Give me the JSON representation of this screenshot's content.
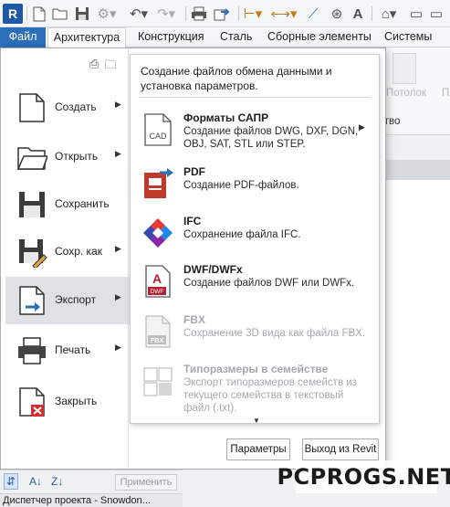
{
  "app": {
    "logo_letter": "R"
  },
  "quick_access": {
    "icons": [
      "open-icon",
      "save-icon",
      "sync-icon",
      "undo-icon",
      "redo-icon",
      "print-icon",
      "export-icon",
      "measure-icon",
      "dimension-icon",
      "tag-icon",
      "text-icon",
      "home-icon",
      "window-icon"
    ]
  },
  "ribbon": {
    "tabs": [
      "Файл",
      "Архитектура",
      "Конструкция",
      "Сталь",
      "Сборные элементы",
      "Системы"
    ],
    "active_tab": "Архитектура",
    "ghost_ceiling": "Потолок",
    "ghost_p": "П",
    "ghost_stvo": "ство"
  },
  "file_menu": {
    "left_items": [
      {
        "label": "Создать",
        "has_submenu": true
      },
      {
        "label": "Открыть",
        "has_submenu": true
      },
      {
        "label": "Сохранить",
        "has_submenu": false
      },
      {
        "label": "Сохр. как",
        "has_submenu": true
      },
      {
        "label": "Экспорт",
        "has_submenu": true,
        "selected": true
      },
      {
        "label": "Печать",
        "has_submenu": true
      },
      {
        "label": "Закрыть",
        "has_submenu": false
      }
    ],
    "export_panel": {
      "header": "Создание файлов обмена данными и установка параметров.",
      "items": [
        {
          "title": "Форматы САПР",
          "desc": "Создание файлов DWG, DXF, DGN, OBJ, SAT, STL или STEP.",
          "enabled": true,
          "submenu": true,
          "icon": "cad-icon",
          "icon_text": "CAD"
        },
        {
          "title": "PDF",
          "desc": "Создание PDF-файлов.",
          "enabled": true,
          "icon": "pdf-icon"
        },
        {
          "title": "IFC",
          "desc": "Сохранение файла IFC.",
          "enabled": true,
          "icon": "ifc-icon"
        },
        {
          "title": "DWF/DWFx",
          "desc": "Создание файлов DWF или DWFx.",
          "enabled": true,
          "icon": "dwf-icon",
          "icon_text": "DWF"
        },
        {
          "title": "FBX",
          "desc": "Сохранение 3D вида как файла FBX.",
          "enabled": false,
          "icon": "fbx-icon",
          "icon_text": "FBX"
        },
        {
          "title": "Типоразмеры в семействе",
          "desc": "Экспорт типоразмеров семейств из текущего семейства в текстовый файл (.txt).",
          "enabled": false,
          "icon": "family-types-icon"
        }
      ]
    },
    "buttons": {
      "options": "Параметры",
      "exit": "Выход из Revit"
    }
  },
  "properties_bar": {
    "apply_label": "Применить"
  },
  "status_bar": {
    "text": "Диспетчер проекта - Snowdon..."
  },
  "watermark": {
    "text": "PCPROGS.NET"
  },
  "colors": {
    "file_tab": "#2a6fb8",
    "selected_item": "#dfe1e4",
    "accent_red": "#b22234",
    "accent_blue": "#2a6fb8"
  }
}
